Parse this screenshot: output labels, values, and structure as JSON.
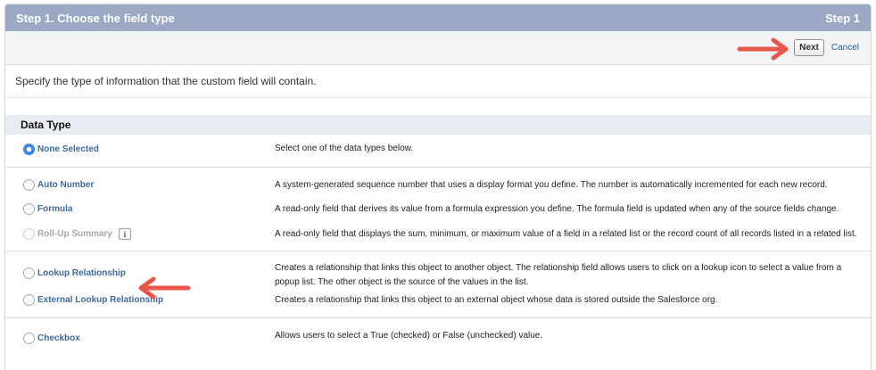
{
  "header": {
    "title": "Step 1. Choose the field type",
    "step": "Step 1"
  },
  "buttons": {
    "next": "Next",
    "cancel": "Cancel"
  },
  "intro": "Specify the type of information that the custom field will contain.",
  "section": {
    "title": "Data Type"
  },
  "options": [
    {
      "label": "None Selected",
      "description": "Select one of the data types below.",
      "selected": true,
      "disabled": false
    },
    {
      "label": "Auto Number",
      "description": "A system-generated sequence number that uses a display format you define. The number is automatically incremented for each new record.",
      "selected": false,
      "disabled": false
    },
    {
      "label": "Formula",
      "description": "A read-only field that derives its value from a formula expression you define. The formula field is updated when any of the source fields change.",
      "selected": false,
      "disabled": false
    },
    {
      "label": "Roll-Up Summary",
      "description": "A read-only field that displays the sum, minimum, or maximum value of a field in a related list or the record count of all records listed in a related list.",
      "selected": false,
      "disabled": true,
      "info_icon": "info-icon",
      "info_text": "i"
    },
    {
      "label": "Lookup Relationship",
      "description": "Creates a relationship that links this object to another object. The relationship field allows users to click on a lookup icon to select a value from a popup list. The other object is the source of the values in the list.",
      "selected": false,
      "disabled": false
    },
    {
      "label": "External Lookup Relationship",
      "description": "Creates a relationship that links this object to an external object whose data is stored outside the Salesforce org.",
      "selected": false,
      "disabled": false
    },
    {
      "label": "Checkbox",
      "description": "Allows users to select a True (checked) or False (unchecked) value.",
      "selected": false,
      "disabled": false
    }
  ],
  "annotations": {
    "arrow_color": "#e8584a"
  },
  "colors": {
    "header_bg": "#9ba9c4",
    "radio_selected": "#3b86e8",
    "label_link": "#3e6aa0"
  }
}
